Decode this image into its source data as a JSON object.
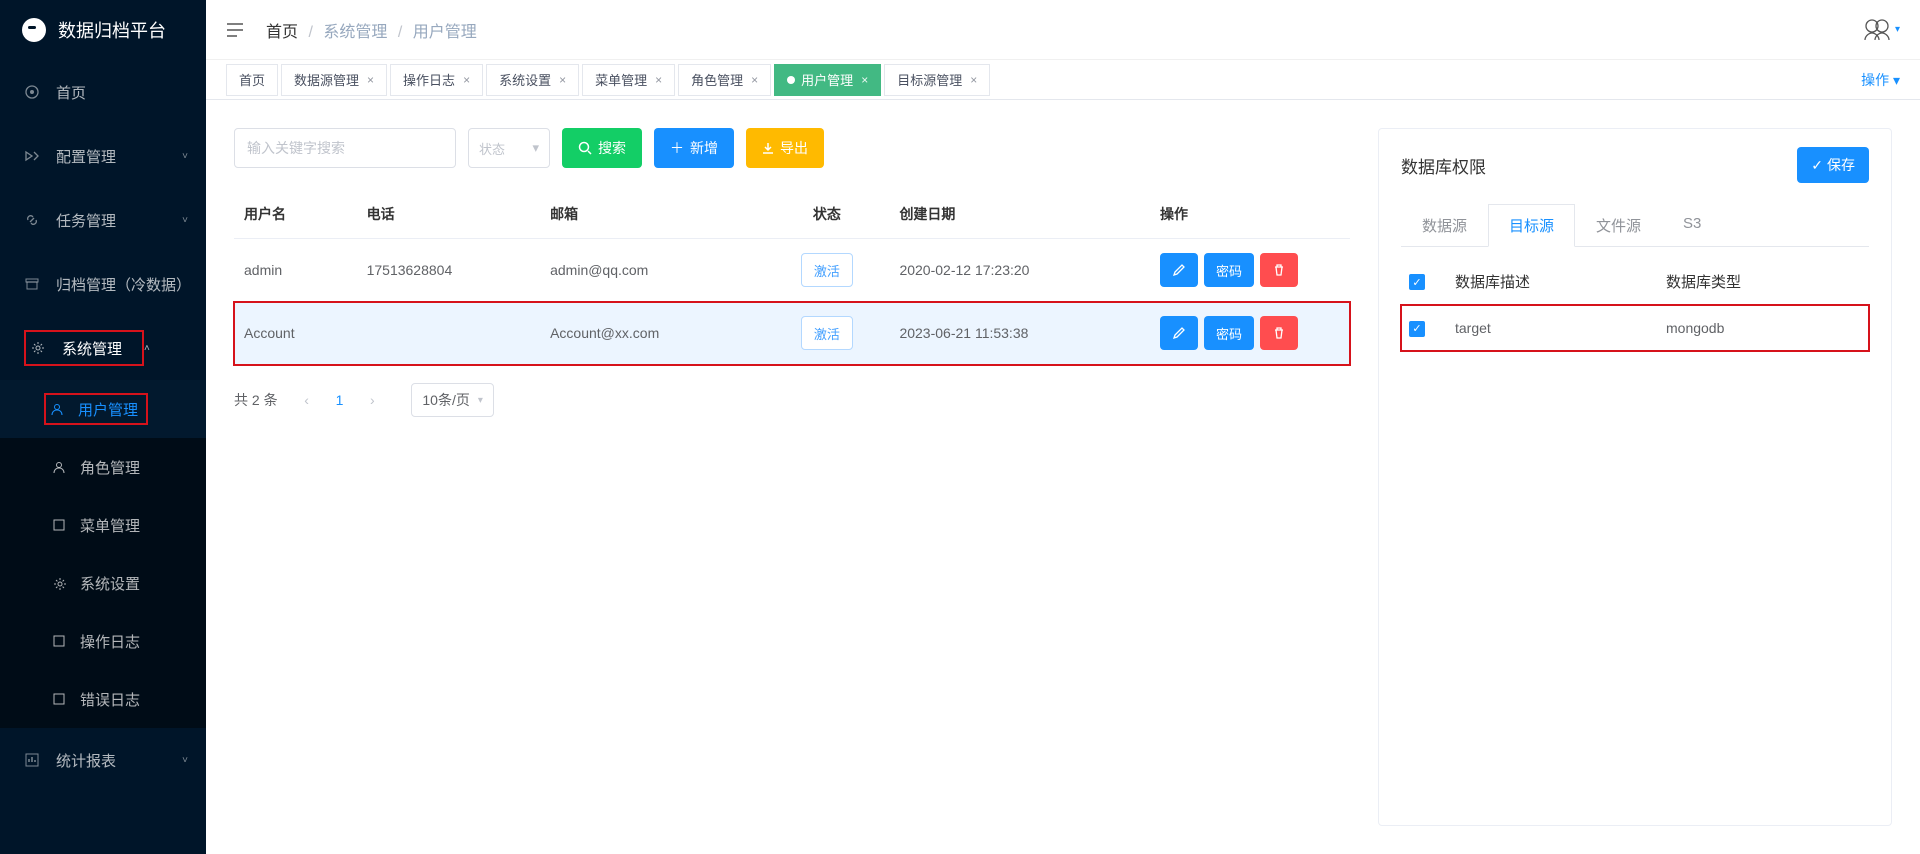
{
  "app": {
    "title": "数据归档平台"
  },
  "breadcrumb": {
    "home": "首页",
    "items": [
      "系统管理",
      "用户管理"
    ]
  },
  "sidebar": {
    "items": [
      {
        "label": "首页",
        "icon": "home"
      },
      {
        "label": "配置管理",
        "icon": "sliders",
        "has_children": true
      },
      {
        "label": "任务管理",
        "icon": "link",
        "has_children": true
      },
      {
        "label": "归档管理（冷数据）",
        "icon": "archive"
      },
      {
        "label": "系统管理",
        "icon": "gear",
        "has_children": true,
        "expanded": true,
        "highlight": true,
        "children": [
          {
            "label": "用户管理",
            "active": true,
            "highlight": true
          },
          {
            "label": "角色管理"
          },
          {
            "label": "菜单管理"
          },
          {
            "label": "系统设置"
          },
          {
            "label": "操作日志"
          },
          {
            "label": "错误日志"
          }
        ]
      },
      {
        "label": "统计报表",
        "icon": "chart",
        "has_children": true
      }
    ]
  },
  "tabs": {
    "items": [
      {
        "label": "首页",
        "closable": false
      },
      {
        "label": "数据源管理",
        "closable": true
      },
      {
        "label": "操作日志",
        "closable": true
      },
      {
        "label": "系统设置",
        "closable": true
      },
      {
        "label": "菜单管理",
        "closable": true
      },
      {
        "label": "角色管理",
        "closable": true
      },
      {
        "label": "用户管理",
        "closable": true,
        "active": true
      },
      {
        "label": "目标源管理",
        "closable": true
      }
    ],
    "ops_label": "操作"
  },
  "toolbar": {
    "search_placeholder": "输入关键字搜索",
    "status_placeholder": "状态",
    "search_btn": "搜索",
    "add_btn": "新增",
    "export_btn": "导出"
  },
  "table": {
    "columns": [
      "用户名",
      "电话",
      "邮箱",
      "状态",
      "创建日期",
      "操作"
    ],
    "rows": [
      {
        "user": "admin",
        "phone": "17513628804",
        "email": "admin@qq.com",
        "status": "激活",
        "date": "2020-02-12 17:23:20",
        "highlight": false
      },
      {
        "user": "Account",
        "phone": "",
        "email": "Account@xx.com",
        "status": "激活",
        "date": "2023-06-21 11:53:38",
        "highlight": true
      }
    ],
    "password_btn": "密码"
  },
  "pagination": {
    "total_text": "共 2 条",
    "current": "1",
    "page_size": "10条/页"
  },
  "right_panel": {
    "title": "数据库权限",
    "save_btn": "保存",
    "subtabs": [
      "数据源",
      "目标源",
      "文件源",
      "S3"
    ],
    "subtab_active": "目标源",
    "columns": {
      "select": "",
      "desc": "数据库描述",
      "type": "数据库类型"
    },
    "header_checked": true,
    "rows": [
      {
        "checked": true,
        "desc": "target",
        "type": "mongodb",
        "highlight": true
      }
    ]
  }
}
